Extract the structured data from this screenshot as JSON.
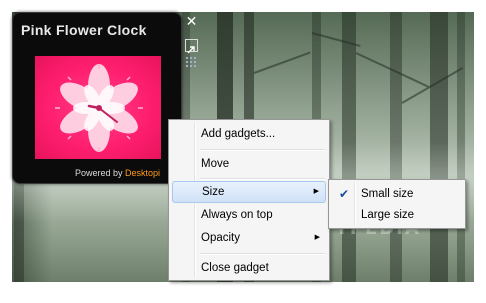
{
  "gadget": {
    "title": "Pink Flower Clock",
    "powered_prefix": "Powered by ",
    "powered_brand": "Desktopi",
    "close_symbol": "✕"
  },
  "context_menu": {
    "items": [
      {
        "label": "Add gadgets..."
      },
      {
        "label": "Move"
      },
      {
        "label": "Size",
        "has_submenu": true,
        "highlighted": true
      },
      {
        "label": "Always on top"
      },
      {
        "label": "Opacity",
        "has_submenu": true
      },
      {
        "label": "Close gadget"
      }
    ],
    "submenu_arrow": "▶"
  },
  "size_submenu": {
    "items": [
      {
        "label": "Small size",
        "checked": true
      },
      {
        "label": "Large size",
        "checked": false
      }
    ],
    "check_mark": "✔"
  },
  "watermark": "SOFTPEDIA",
  "colors": {
    "clock_face": "#ff1f6f",
    "brand": "#ff9a1f",
    "menu_highlight": "#cfe2f8"
  }
}
